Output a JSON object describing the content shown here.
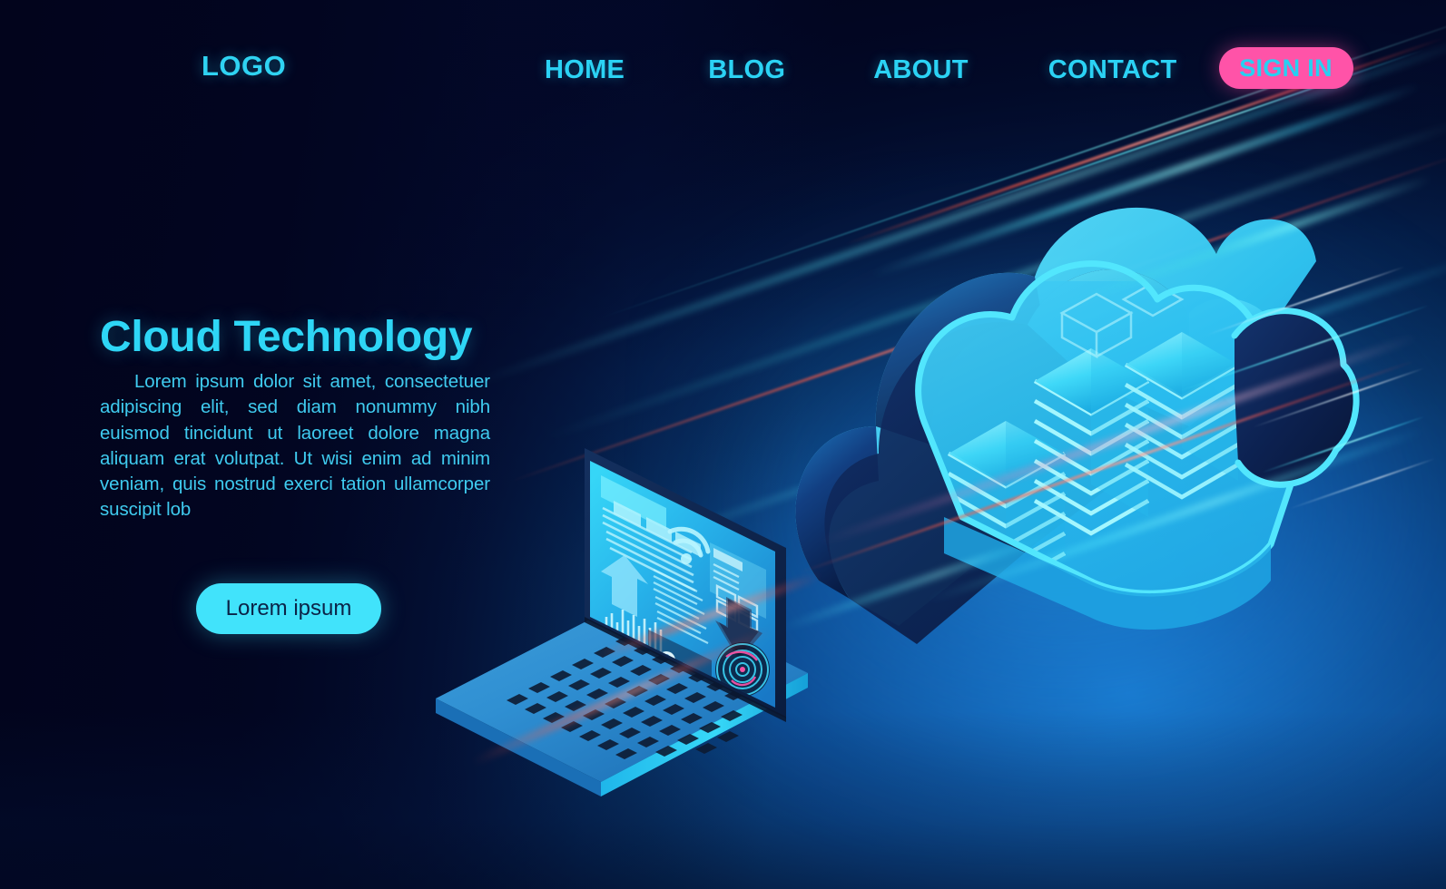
{
  "nav": {
    "logo": "LOGO",
    "links": [
      {
        "label": "HOME"
      },
      {
        "label": "BLOG"
      },
      {
        "label": "ABOUT"
      },
      {
        "label": "CONTACT"
      }
    ],
    "signin_label": "SIGN IN",
    "signin_bg": "#ff53a8",
    "signin_text_color": "#26d0f2",
    "link_color": "#2bd2f4"
  },
  "hero": {
    "title": "Cloud Technology",
    "body": "Lorem ipsum dolor sit amet, consectetuer adipiscing elit, sed diam nonummy nibh euismod tincidunt ut laoreet dolore magna aliquam erat volutpat. Ut wisi enim ad minim veniam, quis nostrud exerci tation ullamcorper suscipit lob",
    "cta_label": "Lorem ipsum",
    "title_color": "#2ed6f6",
    "body_color": "#3fcbef",
    "cta_bg": "#41e3fb",
    "cta_text_color": "#0b2347"
  },
  "illustration": {
    "cloud_outline_color": "#3fe0fb",
    "cloud_body_color": "#29b8ee",
    "cloud_dark_color": "#0b2452",
    "laptop_screen_color": "#2bc4f0",
    "laptop_body_color": "#2a8fd6",
    "accent_red": "#ff5a46",
    "accent_cyan": "#5af0ff",
    "background_deep": "#030632",
    "background_blue": "#1468b8"
  }
}
